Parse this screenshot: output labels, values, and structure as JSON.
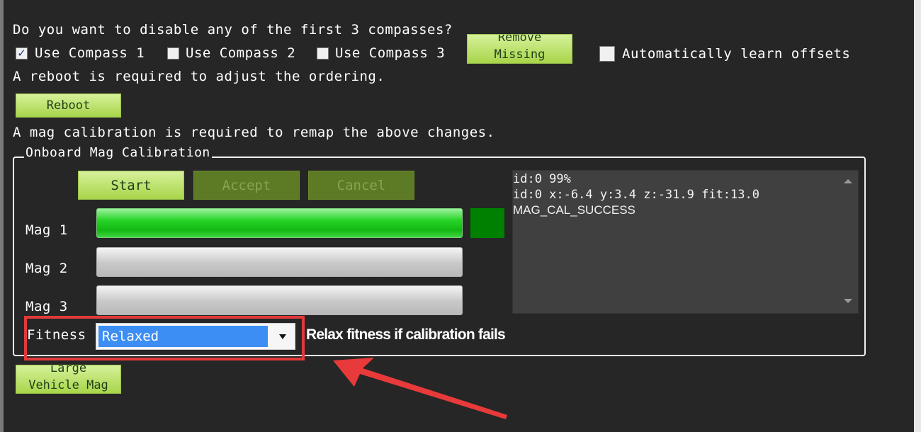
{
  "header": {
    "question": "Do you want to disable any of the first 3 compasses?",
    "reboot_note": "A reboot is required to adjust the ordering.",
    "remap_note": "A mag calibration is required to remap the above changes."
  },
  "compasses": [
    {
      "label": "Use Compass 1",
      "checked": true
    },
    {
      "label": "Use Compass 2",
      "checked": false
    },
    {
      "label": "Use Compass 3",
      "checked": false
    }
  ],
  "remove_missing": {
    "line1": "Remove",
    "line2": "Missing"
  },
  "auto_learn": {
    "label": "Automatically learn offsets",
    "checked": false
  },
  "reboot_button": "Reboot",
  "calibration": {
    "group_title": "Onboard Mag Calibration",
    "start": "Start",
    "accept": "Accept",
    "cancel": "Cancel",
    "mags": [
      {
        "label": "Mag 1",
        "progress": 1.0
      },
      {
        "label": "Mag 2",
        "progress": 0.0
      },
      {
        "label": "Mag 3",
        "progress": 0.0
      }
    ],
    "status_color": "#008000",
    "log_lines": [
      "id:0 99%",
      "id:0 x:-6.4 y:3.4 z:-31.9 fit:13.0",
      "MAG_CAL_SUCCESS"
    ],
    "fitness_label": "Fitness",
    "fitness_value": "Relaxed",
    "fitness_hint": "Relax fitness if calibration fails"
  },
  "large_vehicle": {
    "line1": "Large",
    "line2": "Vehicle Mag"
  },
  "colors": {
    "accent_button": "#b8e06a",
    "highlight_box": "#e23a3a",
    "annotation_arrow": "#e83a3a",
    "selection": "#3d8ef4"
  }
}
